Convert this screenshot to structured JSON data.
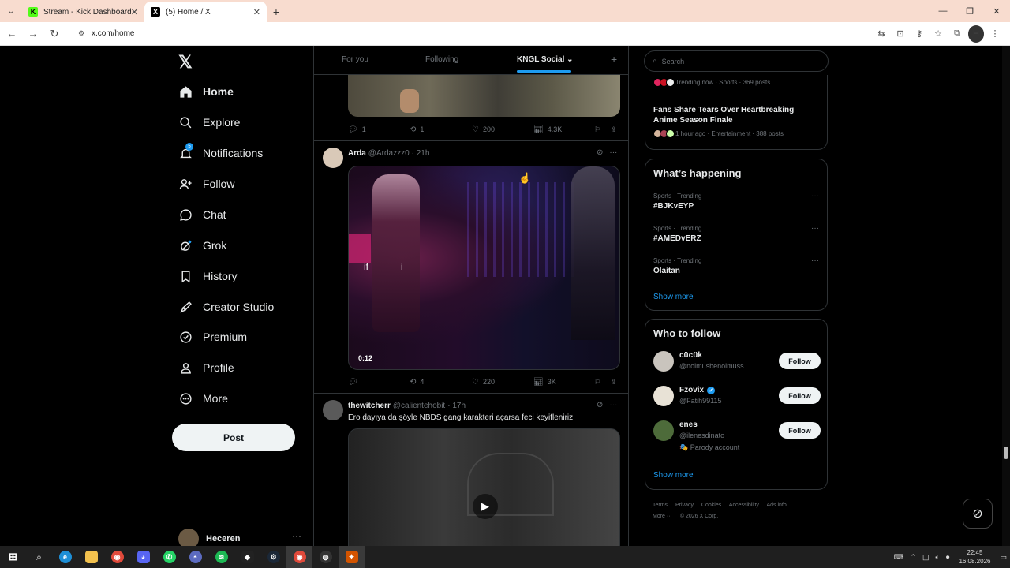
{
  "browser": {
    "tabs": [
      {
        "title": "Stream - Kick Dashboard",
        "favicon": "kick-icon",
        "active": false
      },
      {
        "title": "(5) Home / X",
        "favicon": "x-icon",
        "active": true
      }
    ],
    "new_tab": "+",
    "url": "x.com/home",
    "profile_initial": "H"
  },
  "nav": {
    "logo": "𝕏",
    "items": [
      {
        "label": "Home",
        "icon": "home-icon"
      },
      {
        "label": "Explore",
        "icon": "search-icon"
      },
      {
        "label": "Notifications",
        "icon": "bell-icon",
        "badge": "5"
      },
      {
        "label": "Follow",
        "icon": "add-user-icon"
      },
      {
        "label": "Chat",
        "icon": "chat-icon"
      },
      {
        "label": "Grok",
        "icon": "grok-icon"
      },
      {
        "label": "History",
        "icon": "bookmark-icon"
      },
      {
        "label": "Creator Studio",
        "icon": "rocket-icon"
      },
      {
        "label": "Premium",
        "icon": "verified-icon"
      },
      {
        "label": "Profile",
        "icon": "person-icon"
      },
      {
        "label": "More",
        "icon": "more-icon"
      }
    ],
    "post_label": "Post",
    "user_name": "Heceren"
  },
  "feed": {
    "tabs": [
      "For you",
      "Following",
      "KNGL Social"
    ],
    "active_tab": "KNGL Social",
    "post1_stats": {
      "replies": "1",
      "reposts": "1",
      "likes": "200",
      "views": "4.3K"
    },
    "post2": {
      "name": "Arda",
      "handle": "@Ardazzz0",
      "time": "· 21h",
      "caption_left": "if",
      "caption_right": "i",
      "duration": "0:12",
      "stats": {
        "replies": "",
        "reposts": "4",
        "likes": "220",
        "views": "3K"
      }
    },
    "post3": {
      "name": "thewitcherr",
      "handle": "@calientehobit",
      "time": "· 17h",
      "text": "Ero dayıya da şöyle NBDS gang karakteri açarsa feci keyifleniriz"
    }
  },
  "sidebar": {
    "search_placeholder": "Search",
    "trend_top_meta": "Trending now · Sports · 369 posts",
    "headline": "Fans Share Tears Over Heartbreaking Anime Season Finale",
    "headline_meta": "1 hour ago · Entertainment · 388 posts",
    "happening_title": "What’s happening",
    "trends": [
      {
        "context": "Sports · Trending",
        "name": "#BJKvEYP"
      },
      {
        "context": "Sports · Trending",
        "name": "#AMEDvERZ"
      },
      {
        "context": "Sports · Trending",
        "name": "Olaitan"
      }
    ],
    "show_more": "Show more",
    "who_title": "Who to follow",
    "who": [
      {
        "name": "cücük",
        "handle": "@nolmusbenolmuss",
        "verified": false,
        "parody": ""
      },
      {
        "name": "Fzovix",
        "handle": "@Fatih99115",
        "verified": true,
        "parody": ""
      },
      {
        "name": "enes",
        "handle": "@ilenesdinato",
        "verified": false,
        "parody": "🎭 Parody account"
      }
    ],
    "follow_label": "Follow",
    "footer": [
      "Terms",
      "Privacy",
      "Cookies",
      "Accessibility",
      "Ads info",
      "More ···",
      "© 2026 X Corp."
    ]
  },
  "taskbar": {
    "time": "22:45",
    "date": "16.08.2026"
  }
}
